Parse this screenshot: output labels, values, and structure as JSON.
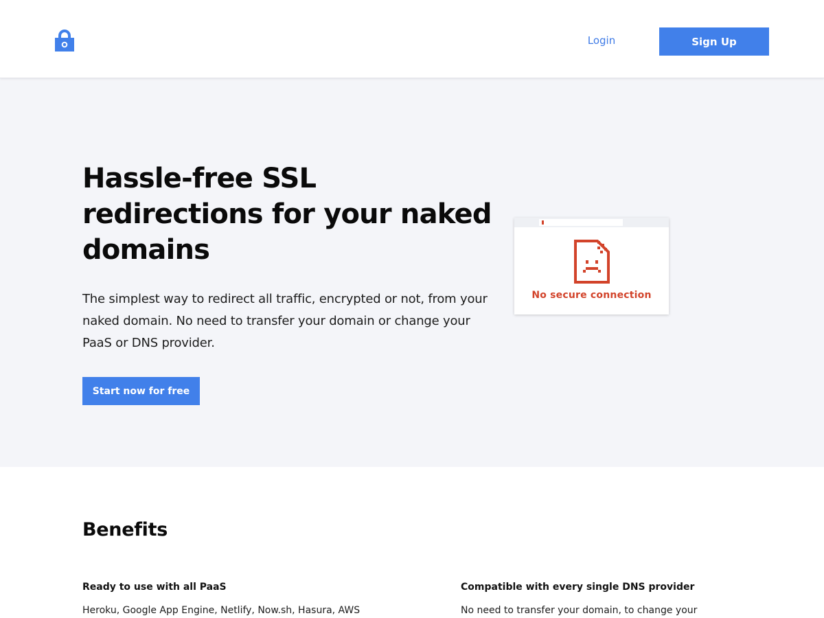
{
  "header": {
    "logo_icon": "padlock-icon",
    "login_label": "Login",
    "signup_label": "Sign Up"
  },
  "hero": {
    "title": "Hassle-free SSL redirections for your naked domains",
    "description": "The simplest way to redirect all traffic, encrypted or not, from your naked domain. No need to transfer your domain or change your PaaS or DNS provider.",
    "cta_label": "Start now for free",
    "illustration": {
      "icon": "broken-page-icon",
      "label": "No secure connection"
    }
  },
  "benefits": {
    "title": "Benefits",
    "items": [
      {
        "title": "Ready to use with all PaaS",
        "text": "Heroku, Google App Engine, Netlify, Now.sh, Hasura, AWS"
      },
      {
        "title": "Compatible with every single DNS provider",
        "text": "No need to transfer your domain, to change your"
      }
    ]
  },
  "colors": {
    "accent": "#4180ea",
    "link": "#3f7be6",
    "warning": "#d2432a",
    "hero_background": "#f4f5f9"
  }
}
